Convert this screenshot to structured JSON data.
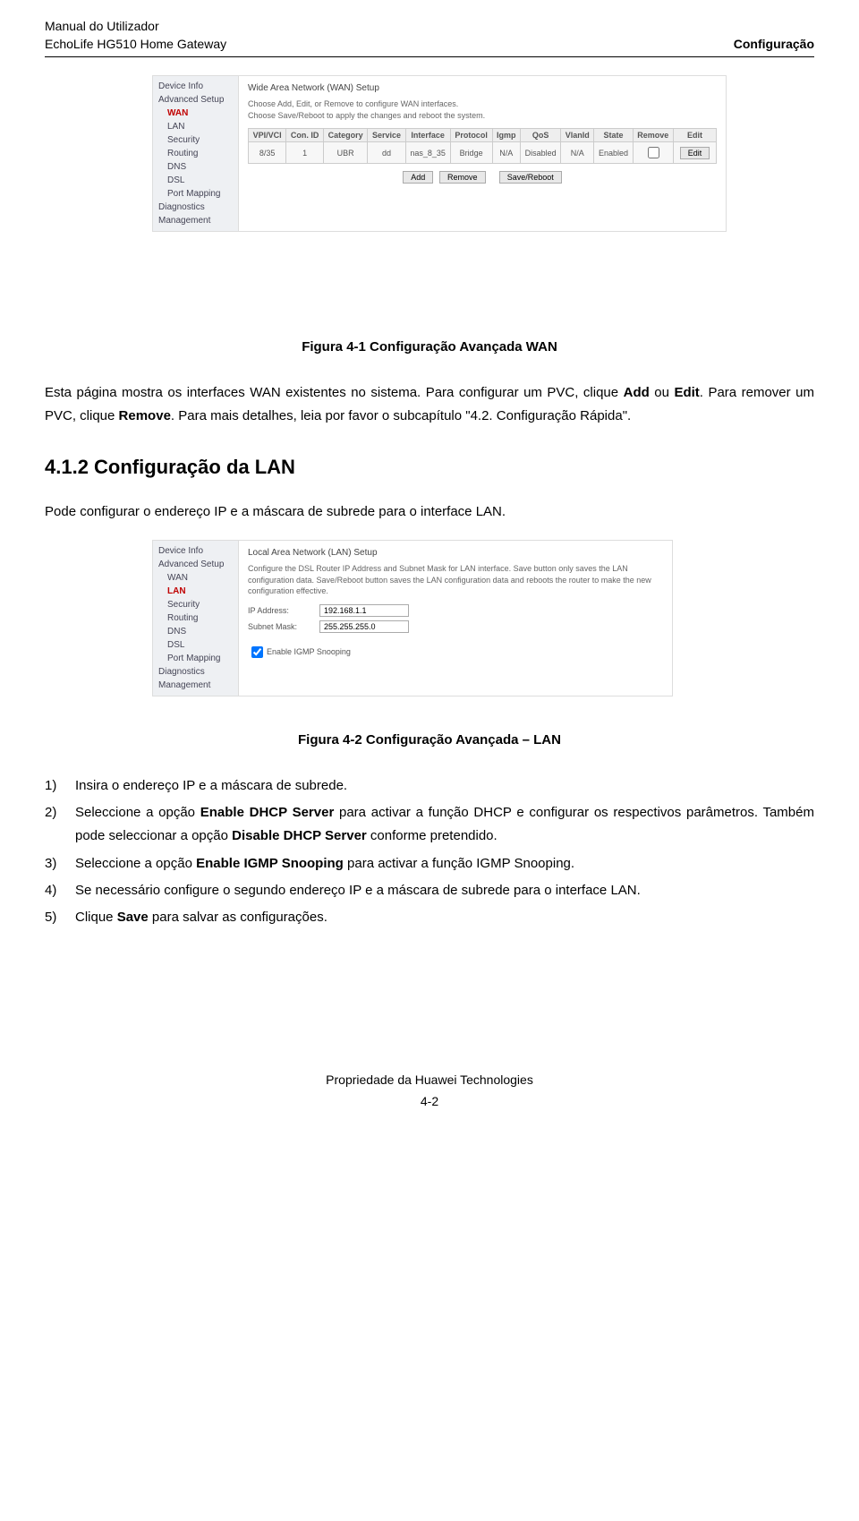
{
  "header": {
    "left_line1": "Manual do Utilizador",
    "left_line2": "EchoLife HG510 Home Gateway",
    "right": "Configuração"
  },
  "screenshot1": {
    "sidebar": {
      "items": [
        {
          "label": "Device Info",
          "sub": false,
          "active": false
        },
        {
          "label": "Advanced Setup",
          "sub": false,
          "active": false
        },
        {
          "label": "WAN",
          "sub": true,
          "active": true
        },
        {
          "label": "LAN",
          "sub": true,
          "active": false
        },
        {
          "label": "Security",
          "sub": true,
          "active": false
        },
        {
          "label": "Routing",
          "sub": true,
          "active": false
        },
        {
          "label": "DNS",
          "sub": true,
          "active": false
        },
        {
          "label": "DSL",
          "sub": true,
          "active": false
        },
        {
          "label": "Port Mapping",
          "sub": true,
          "active": false
        },
        {
          "label": "Diagnostics",
          "sub": false,
          "active": false
        },
        {
          "label": "Management",
          "sub": false,
          "active": false
        }
      ]
    },
    "title": "Wide Area Network (WAN) Setup",
    "desc1": "Choose Add, Edit, or Remove to configure WAN interfaces.",
    "desc2": "Choose Save/Reboot to apply the changes and reboot the system.",
    "table": {
      "headers": [
        "VPI/VCI",
        "Con. ID",
        "Category",
        "Service",
        "Interface",
        "Protocol",
        "Igmp",
        "QoS",
        "VlanId",
        "State",
        "Remove",
        "Edit"
      ],
      "row": [
        "8/35",
        "1",
        "UBR",
        "dd",
        "nas_8_35",
        "Bridge",
        "N/A",
        "Disabled",
        "N/A",
        "Enabled",
        "",
        "Edit"
      ]
    },
    "buttons": {
      "add": "Add",
      "remove": "Remove",
      "save": "Save/Reboot"
    }
  },
  "caption1": "Figura 4-1 Configuração Avançada WAN",
  "para1_parts": {
    "p1a": "Esta página mostra os interfaces WAN existentes no sistema. Para configurar um PVC, clique ",
    "p1b": "Add",
    "p1c": " ou ",
    "p1d": "Edit",
    "p1e": ". Para remover um PVC, clique ",
    "p1f": "Remove",
    "p1g": ". Para mais detalhes, leia por favor o subcapítulo \"4.2. Configuração Rápida\"."
  },
  "heading412": "4.1.2  Configuração da LAN",
  "para2": "Pode configurar o endereço IP e a máscara de subrede para o interface LAN.",
  "screenshot2": {
    "sidebar": {
      "items": [
        {
          "label": "Device Info",
          "sub": false,
          "active": false
        },
        {
          "label": "Advanced Setup",
          "sub": false,
          "active": false
        },
        {
          "label": "WAN",
          "sub": true,
          "active": false
        },
        {
          "label": "LAN",
          "sub": true,
          "active": true
        },
        {
          "label": "Security",
          "sub": true,
          "active": false
        },
        {
          "label": "Routing",
          "sub": true,
          "active": false
        },
        {
          "label": "DNS",
          "sub": true,
          "active": false
        },
        {
          "label": "DSL",
          "sub": true,
          "active": false
        },
        {
          "label": "Port Mapping",
          "sub": true,
          "active": false
        },
        {
          "label": "Diagnostics",
          "sub": false,
          "active": false
        },
        {
          "label": "Management",
          "sub": false,
          "active": false
        }
      ]
    },
    "title": "Local Area Network (LAN) Setup",
    "desc": "Configure the DSL Router IP Address and Subnet Mask for LAN interface. Save button only saves the LAN configuration data. Save/Reboot button saves the LAN configuration data and reboots the router to make the new configuration effective.",
    "ip_label": "IP Address:",
    "ip_value": "192.168.1.1",
    "mask_label": "Subnet Mask:",
    "mask_value": "255.255.255.0",
    "igmp_label": "Enable IGMP Snooping"
  },
  "caption2": "Figura 4-2 Configuração Avançada – LAN",
  "steps": {
    "s1": "Insira o endereço IP e a máscara de subrede.",
    "s2a": "Seleccione a opção ",
    "s2b": "Enable DHCP Server",
    "s2c": " para activar a função DHCP e configurar os respectivos parâmetros. Também pode seleccionar a opção ",
    "s2d": "Disable DHCP Server",
    "s2e": " conforme pretendido.",
    "s3a": "Seleccione a opção ",
    "s3b": "Enable IGMP Snooping",
    "s3c": " para activar a função  IGMP Snooping.",
    "s4": "Se necessário configure o segundo endereço IP e a máscara de subrede para o interface LAN.",
    "s5a": "Clique ",
    "s5b": "Save",
    "s5c": " para salvar as configurações."
  },
  "footer": {
    "line1": "Propriedade da Huawei Technologies",
    "line2": "4-2"
  }
}
